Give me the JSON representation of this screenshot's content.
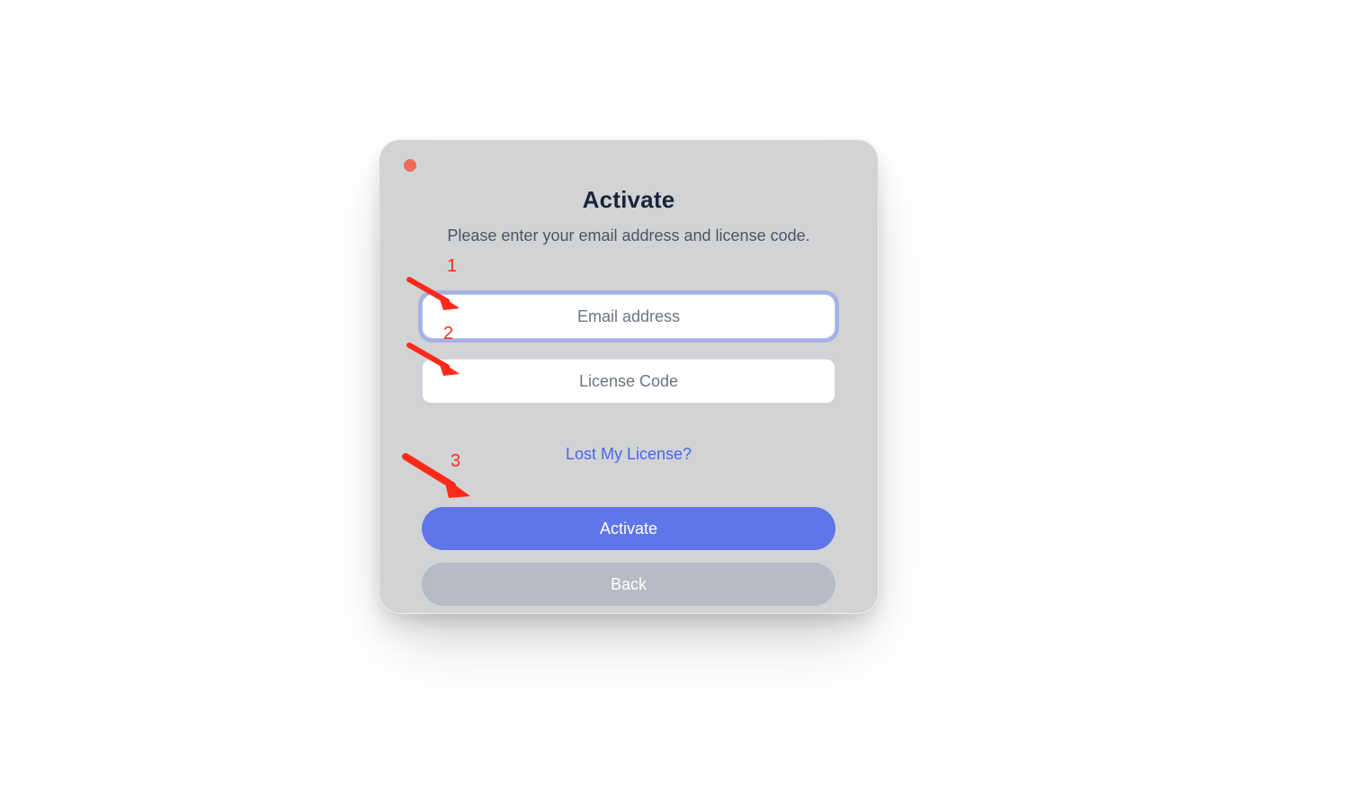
{
  "dialog": {
    "title": "Activate",
    "subtitle": "Please enter your email address and license code.",
    "email_placeholder": "Email address",
    "license_placeholder": "License Code",
    "lost_link": "Lost My License?",
    "activate_label": "Activate",
    "back_label": "Back"
  },
  "annotations": {
    "n1": "1",
    "n2": "2",
    "n3": "3"
  },
  "colors": {
    "dialog_bg": "#d2d3d5",
    "primary": "#5f76e8",
    "secondary": "#b7bbc6",
    "link": "#4965f0",
    "traffic_close": "#f06b5d",
    "annotation": "#ff2a1a"
  }
}
